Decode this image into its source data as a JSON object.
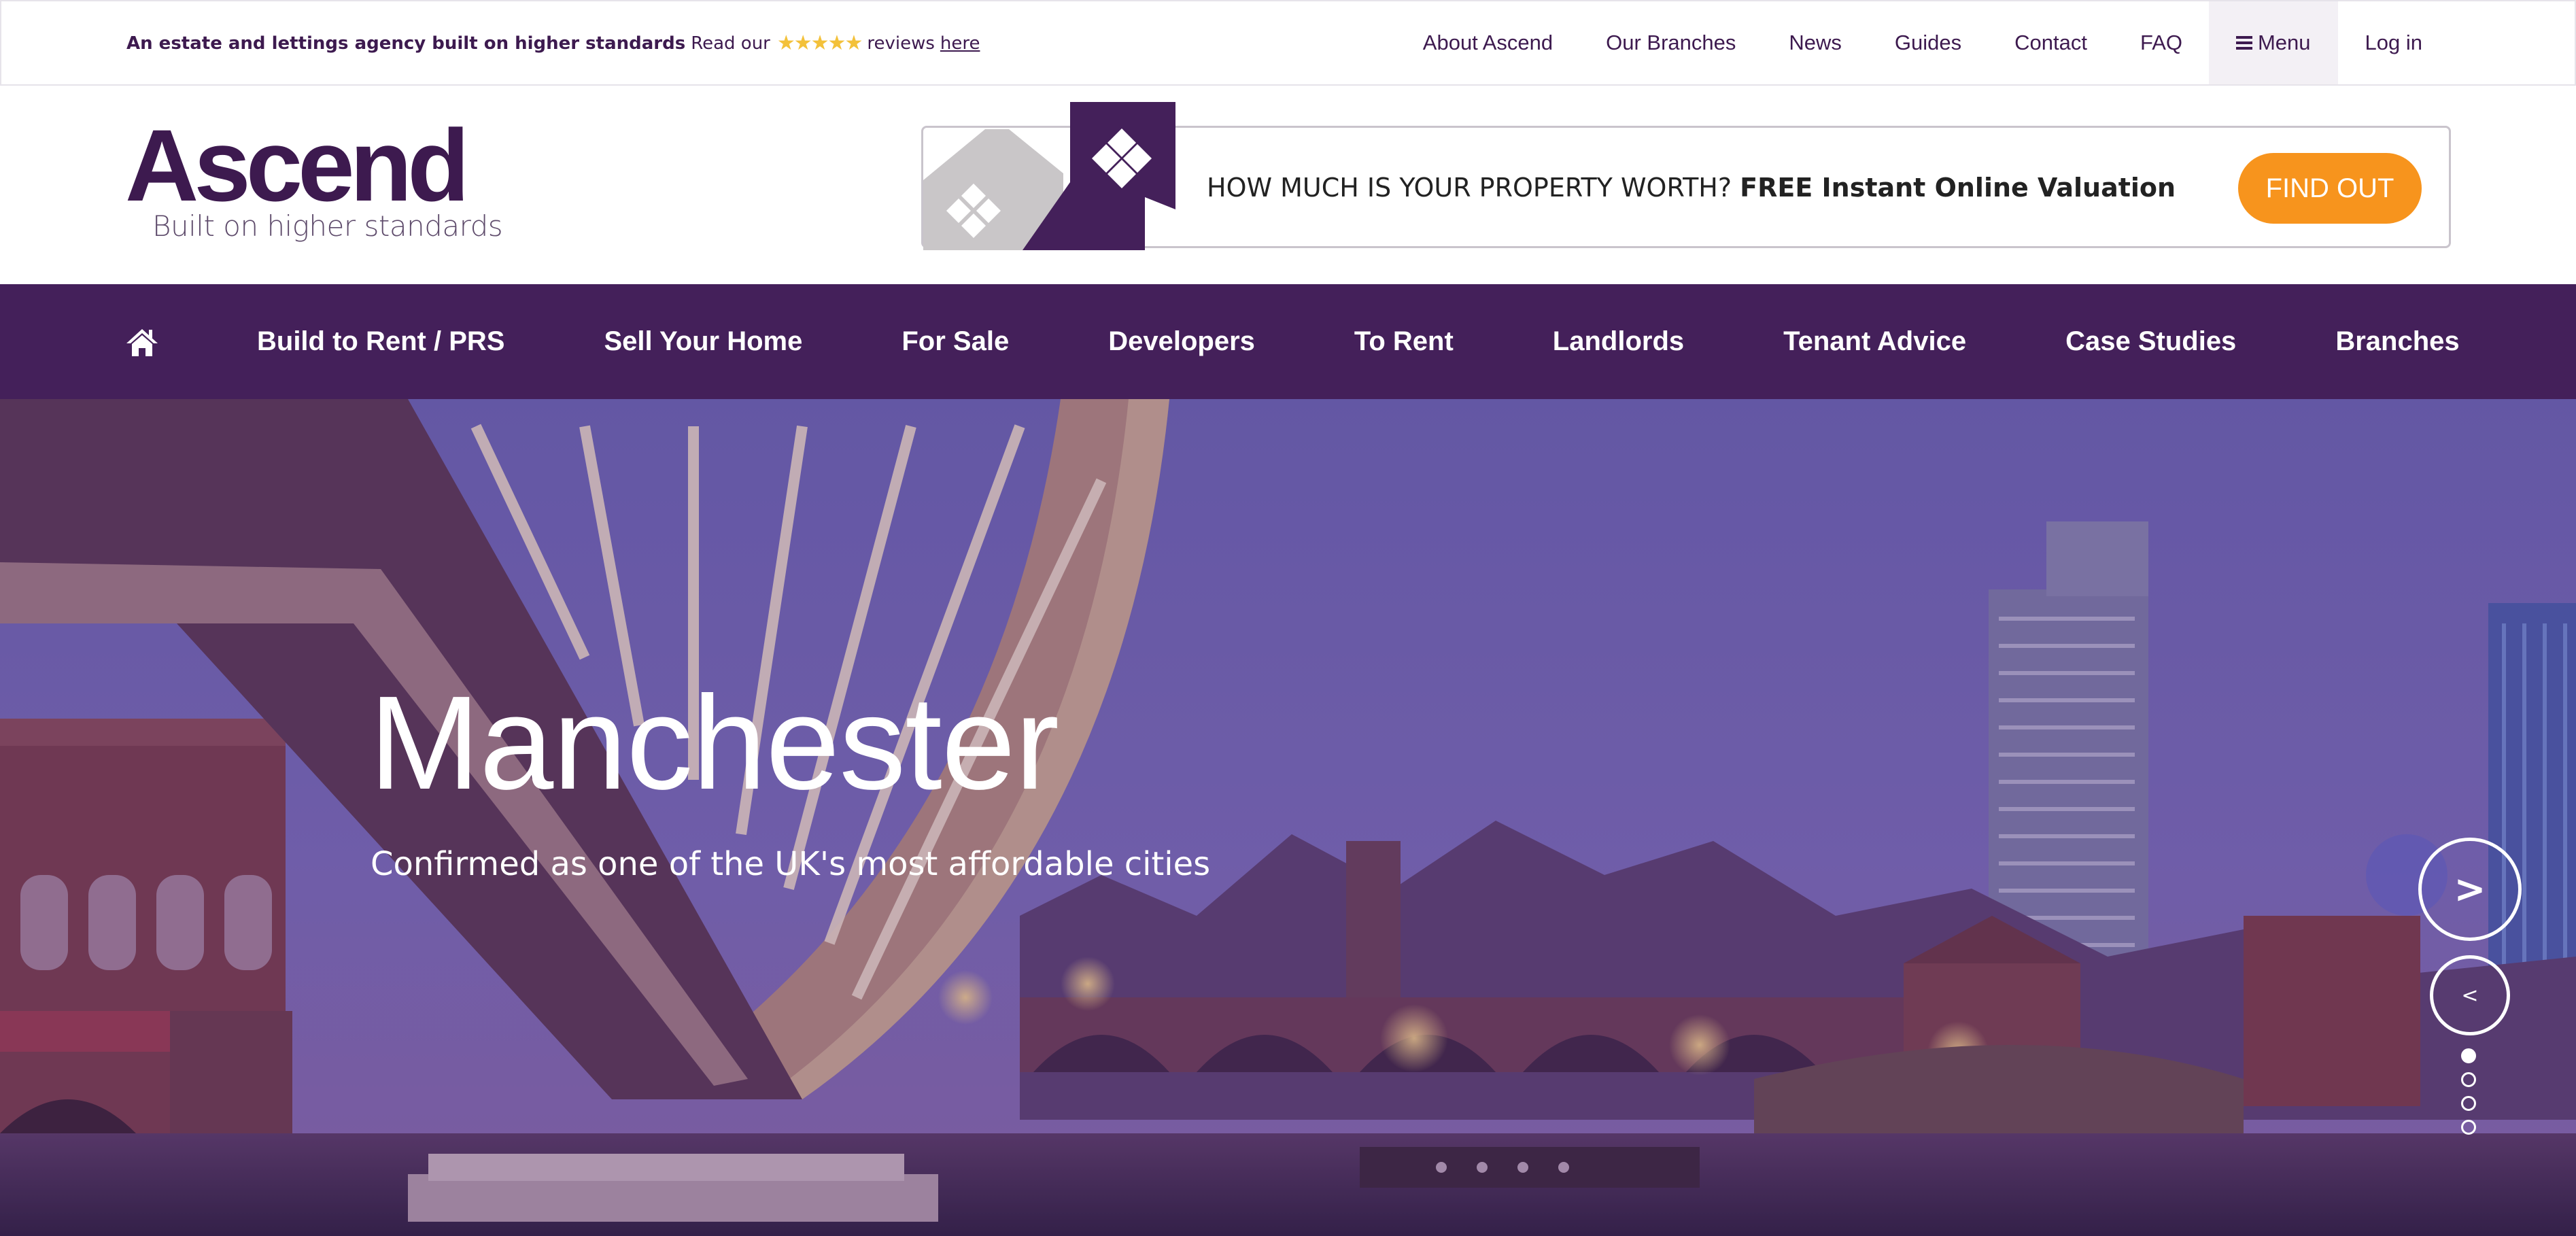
{
  "topbar": {
    "tagline": "An estate and lettings agency built on higher standards",
    "read_our": "Read our",
    "stars": "★★★★★",
    "reviews": "reviews",
    "here": "here",
    "links": {
      "about": "About Ascend",
      "branches": "Our Branches",
      "news": "News",
      "guides": "Guides",
      "contact": "Contact",
      "faq": "FAQ",
      "menu": "Menu",
      "login": "Log in"
    }
  },
  "header": {
    "logo": "Ascend",
    "logo_tagline": "Built on higher standards",
    "valuation": {
      "question": "HOW MUCH IS YOUR PROPERTY WORTH?",
      "offer": "FREE Instant Online Valuation",
      "button": "FIND OUT"
    }
  },
  "mainnav": {
    "items": [
      "Build to Rent / PRS",
      "Sell Your Home",
      "For Sale",
      "Developers",
      "To Rent",
      "Landlords",
      "Tenant Advice",
      "Case Studies",
      "Branches"
    ]
  },
  "hero": {
    "title": "Manchester",
    "subtitle": "Confirmed as one of the UK's most affordable cities",
    "next": ">",
    "prev": "<",
    "slides": 4,
    "active_slide": 1
  },
  "colors": {
    "brand_purple": "#44205a",
    "text_purple": "#3d1a4f",
    "accent_orange": "#f7941d",
    "star_yellow": "#f3c13a"
  },
  "icons": {
    "home": "home-icon",
    "menu": "menu-icon",
    "valuation": "house-diamond-icon"
  }
}
